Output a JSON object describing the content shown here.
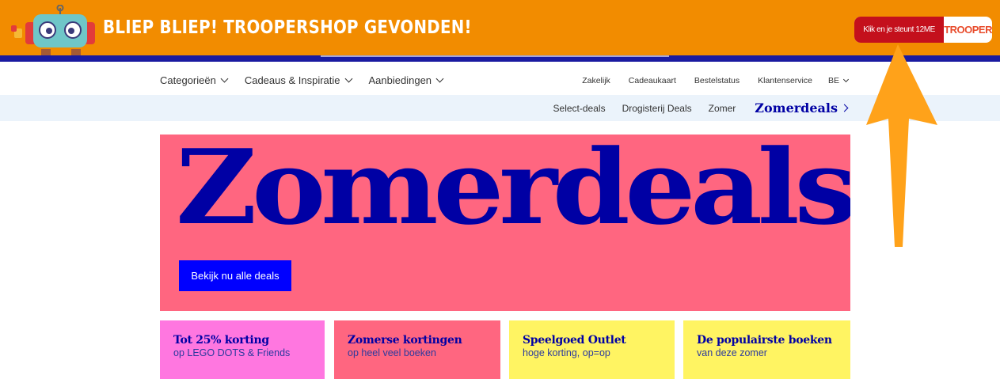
{
  "trooper": {
    "title": "BLIEP BLIEP! TROOPERSHOP GEVONDEN!",
    "support_label": "Klik en je steunt 12ME",
    "logo_text": "TROOPER"
  },
  "nav": {
    "left": [
      {
        "label": "Categorieën"
      },
      {
        "label": "Cadeaus & Inspiratie"
      },
      {
        "label": "Aanbiedingen"
      }
    ],
    "right": [
      {
        "label": "Zakelijk"
      },
      {
        "label": "Cadeaukaart"
      },
      {
        "label": "Bestelstatus"
      },
      {
        "label": "Klantenservice"
      }
    ],
    "country": "BE"
  },
  "subnav": {
    "items": [
      "Select-deals",
      "Drogisterij Deals",
      "Zomer"
    ],
    "active": "Zomerdeals"
  },
  "hero": {
    "title": "Zomerdeals",
    "button": "Bekijk nu alle deals"
  },
  "tiles": [
    {
      "title": "Tot 25% korting",
      "subtitle": "op LEGO DOTS & Friends",
      "color": "#ff77e0"
    },
    {
      "title": "Zomerse kortingen",
      "subtitle": "op heel veel boeken",
      "color": "#ff6680"
    },
    {
      "title": "Speelgoed Outlet",
      "subtitle": "hoge korting, op=op",
      "color": "#fff462"
    },
    {
      "title": "De populairste boeken",
      "subtitle": "van deze zomer",
      "color": "#fff462"
    }
  ],
  "colors": {
    "trooper_orange": "#f28c00",
    "brand_blue": "#0000a4",
    "hero_pink": "#ff6680",
    "button_blue": "#0000ff",
    "arrow": "#ffa21a"
  }
}
